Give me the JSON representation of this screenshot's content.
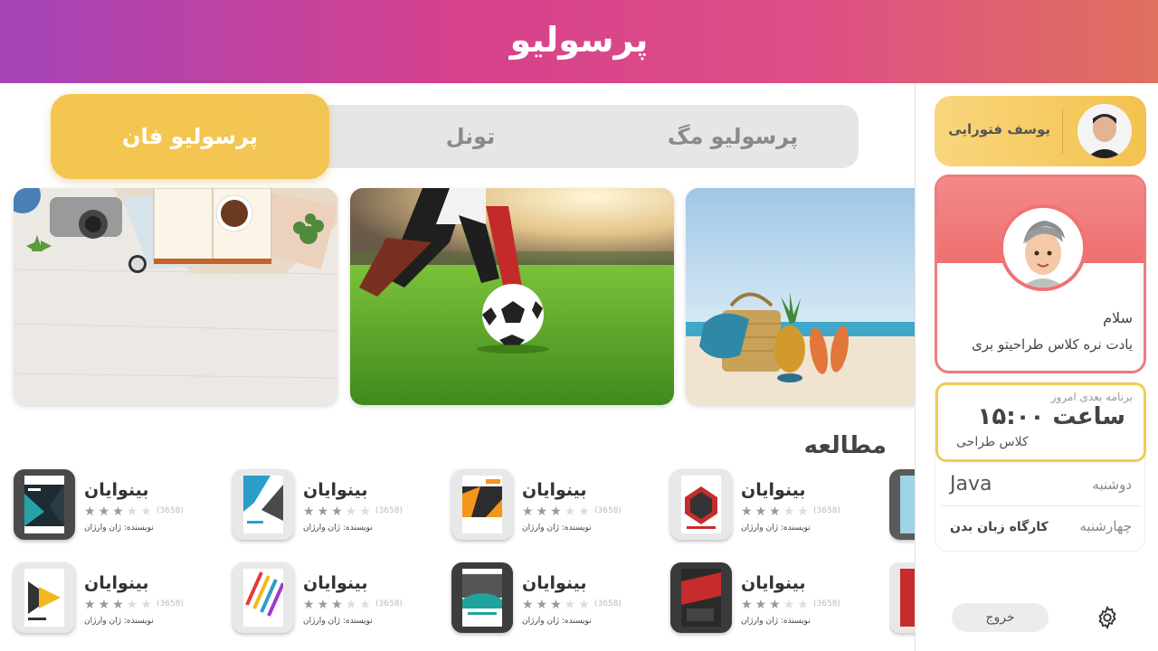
{
  "header": {
    "logo": "پرسولیو"
  },
  "tabs": [
    {
      "label": "پرسولیو فان",
      "active": true
    },
    {
      "label": "تونل",
      "active": false
    },
    {
      "label": "پرسولیو مگ",
      "active": false
    }
  ],
  "banners": [
    {
      "icon": "travel-desk-image"
    },
    {
      "icon": "soccer-image"
    },
    {
      "icon": "beach-image"
    }
  ],
  "section": {
    "title": "مطالعه"
  },
  "books": [
    {
      "title": "بینوایان",
      "stars": "★★★★★",
      "count": "(3658)",
      "author": "نویسنده: ژان وارژان"
    },
    {
      "title": "بینوایان",
      "stars": "★★★★★",
      "count": "(3658)",
      "author": "نویسنده: ژان وارژان"
    },
    {
      "title": "بینوایان",
      "stars": "★★★★★",
      "count": "(3658)",
      "author": "نویسنده: ژان وارژان"
    },
    {
      "title": "بینوایان",
      "stars": "★★★★★",
      "count": "(3658)",
      "author": "نویسنده: ژان وارژان"
    },
    {
      "title": "بینوایان",
      "stars": "★★★★★",
      "count": "(3658)",
      "author": "نویسنده: ژان وارژان"
    },
    {
      "title": "بینوایان",
      "stars": "★★★★★",
      "count": "(3658)",
      "author": "نویسنده: ژان وارژان"
    },
    {
      "title": "بینوایان",
      "stars": "★★★★★",
      "count": "(3658)",
      "author": "نویسنده: ژان وارژان"
    },
    {
      "title": "بینوایان",
      "stars": "★★★★★",
      "count": "(3658)",
      "author": "نویسنده: ژان وارژان"
    }
  ],
  "rating": {
    "filled": 3,
    "max": 5
  },
  "sidebar": {
    "user_name": "یوسف فتورایی",
    "greeting": "سلام",
    "message": "یادت نره کلاس طراحیتو بری",
    "next_label": "برنامه بعدی امروز",
    "next_time": "ساعت ۱۵:۰۰",
    "next_class": "کلاس طراحی",
    "schedule": [
      {
        "day": "دوشنبه",
        "subject": "Java"
      },
      {
        "day": "چهارشنبه",
        "subject": "کارگاه زبان بدن"
      }
    ],
    "logout": "خروج"
  },
  "colors": {
    "accent": "#f3c24e",
    "header_start": "#a544b8",
    "header_end": "#e0705e",
    "greeting": "#ee7b7b"
  }
}
